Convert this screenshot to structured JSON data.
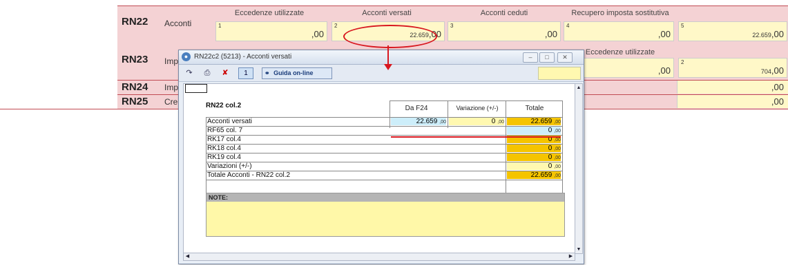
{
  "form": {
    "rows": [
      {
        "code": "RN22",
        "label": "Acconti"
      },
      {
        "code": "RN23",
        "label": "Imp"
      },
      {
        "code": "RN24",
        "label": "Imp"
      },
      {
        "code": "RN25",
        "label": "Cre"
      }
    ],
    "rn22": {
      "col_headers": [
        "Eccedenze utilizzate",
        "Acconti versati",
        "Acconti ceduti",
        "Recupero imposta sostitutiva"
      ],
      "fields": [
        {
          "index": "1",
          "value": "",
          "dec": ",00"
        },
        {
          "index": "2",
          "value": "22.659",
          "dec": ",00"
        },
        {
          "index": "3",
          "value": "",
          "dec": ",00"
        },
        {
          "index": "4",
          "value": "",
          "dec": ",00"
        },
        {
          "index": "5",
          "value": "22.659",
          "dec": ",00"
        }
      ]
    },
    "rn23": {
      "col_header": "Eccedenze utilizzate",
      "fields": [
        {
          "index": "1",
          "value": "",
          "dec": ",00"
        },
        {
          "index": "2",
          "value": "704",
          "dec": ",00"
        }
      ]
    },
    "rn24_dec": ",00",
    "rn25_dec": ",00"
  },
  "dialog": {
    "title": "RN22c2 (5213) - Acconti versati",
    "window_buttons": [
      "minimize",
      "restore",
      "close"
    ],
    "toolbar": {
      "page": "1",
      "help_label": "Guida on-line"
    },
    "table": {
      "heading": "RN22 col.2",
      "col_headers": [
        "Da F24",
        "Variazione  (+/-)",
        "Totale"
      ],
      "rows": [
        {
          "label": "Acconti versati",
          "f24": "22.659",
          "var": "0",
          "tot": "22.659",
          "dec": ",00"
        },
        {
          "label": "RF65 col. 7",
          "tot": "0",
          "dec": ",00"
        },
        {
          "label": "RK17 col.4",
          "tot": "0",
          "dec": ",00"
        },
        {
          "label": "RK18 col.4",
          "tot": "0",
          "dec": ",00"
        },
        {
          "label": "RK19 col.4",
          "tot": "0",
          "dec": ",00"
        },
        {
          "label": "Variazioni (+/-)",
          "tot": "0",
          "dec": ",00"
        },
        {
          "label": "Totale Acconti - RN22 col.2",
          "tot": "22.659",
          "dec": ",00"
        }
      ]
    },
    "notes_label": "NOTE:"
  },
  "colors": {
    "form_row_bg": "#f4d2d4",
    "field_bg": "#fff8c8",
    "highlight_orange": "#f5c400",
    "highlight_blue": "#cdeefa",
    "annotation_red": "#d8171f"
  }
}
